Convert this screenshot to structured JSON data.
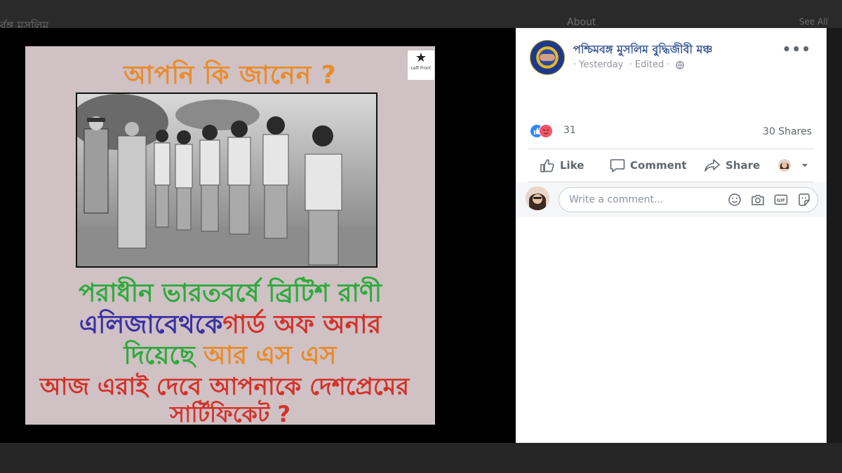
{
  "background": {
    "top_left_text": "র্বঙ্গ মুসলিম",
    "about_text": "About",
    "see_all_text": "See All"
  },
  "poster": {
    "title": "আপনি কি জানেন ?",
    "logo_text": "Left Front",
    "line1": "পরাধীন ভারতবর্ষে ব্রিটিশ রাণী",
    "line2_a": "এলিজাবেথকে",
    "line2_b": "গার্ড অফ অনার",
    "line3_a": "দিয়েছে",
    "line3_b": " আর এস এস",
    "line4": "আজ এরাই দেবে আপনাকে দেশপ্রেমের",
    "line5": "সার্টিফিকেট ?",
    "colors": {
      "orange": "#e98b2a",
      "green": "#2eaa3c",
      "blue": "#3a31a6",
      "red": "#d4322a",
      "background": "#cfc1c4"
    }
  },
  "post": {
    "page_name": "পশ্চিমবঙ্গ মুসলিম বুদ্ধিজীবী মঞ্চ",
    "time": "· Yesterday",
    "edited": "· Edited ·",
    "privacy_icon": "globe-icon",
    "more_label": "•••",
    "reaction_icons": [
      "like-reaction-icon",
      "angry-reaction-icon"
    ],
    "reaction_count": "31",
    "shares": "30 Shares",
    "actions": {
      "like": "Like",
      "comment": "Comment",
      "share": "Share"
    },
    "comment_placeholder": "Write a comment...",
    "comment_icons": [
      "emoji-icon",
      "camera-icon",
      "gif-icon",
      "sticker-icon"
    ],
    "link_color": "#385898"
  }
}
